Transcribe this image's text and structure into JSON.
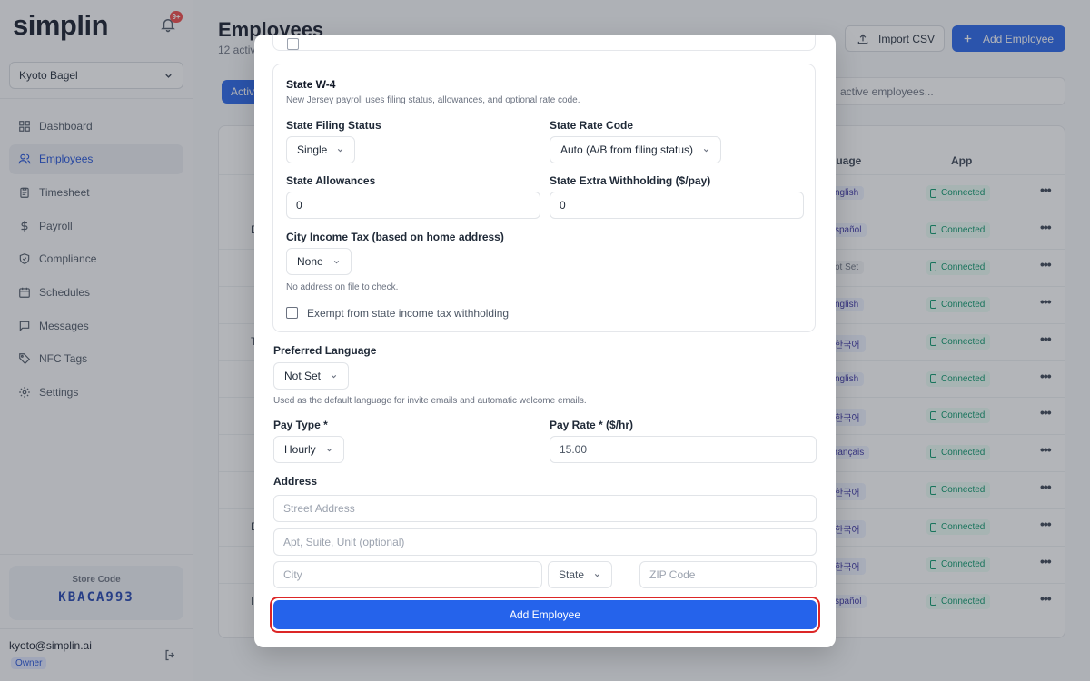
{
  "sidebar": {
    "logo": "simplin",
    "notification_count": "9+",
    "store_name": "Kyoto Bagel",
    "nav": [
      {
        "label": "Dashboard",
        "icon": "dashboard-icon"
      },
      {
        "label": "Employees",
        "icon": "users-icon",
        "active": true
      },
      {
        "label": "Timesheet",
        "icon": "clipboard-icon"
      },
      {
        "label": "Payroll",
        "icon": "dollar-icon"
      },
      {
        "label": "Compliance",
        "icon": "shield-icon"
      },
      {
        "label": "Schedules",
        "icon": "calendar-icon"
      },
      {
        "label": "Messages",
        "icon": "message-icon"
      },
      {
        "label": "NFC Tags",
        "icon": "tag-icon"
      },
      {
        "label": "Settings",
        "icon": "gear-icon"
      }
    ],
    "store_code_label": "Store Code",
    "store_code": "KBACA993",
    "user_email": "kyoto@simplin.ai",
    "user_role": "Owner"
  },
  "main": {
    "title": "Employees",
    "subtitle": "12 activ",
    "import_label": "Import CSV",
    "add_label": "Add Employee",
    "active_tab": "Activ",
    "search_placeholder": "active employees...",
    "columns": {
      "language": "guage",
      "app": "App"
    },
    "rows": [
      {
        "initial": "",
        "language": "nglish",
        "app": "Connected"
      },
      {
        "initial": "D",
        "language": "spañol",
        "app": "Connected"
      },
      {
        "initial": "",
        "language": "ot Set",
        "app": "Connected"
      },
      {
        "initial": "",
        "language": "nglish",
        "app": "Connected"
      },
      {
        "initial": "T",
        "language": "한국어",
        "app": "Connected"
      },
      {
        "initial": "",
        "language": "nglish",
        "app": "Connected"
      },
      {
        "initial": "",
        "language": "한국어",
        "app": "Connected"
      },
      {
        "initial": "",
        "language": "rançais",
        "app": "Connected"
      },
      {
        "initial": "",
        "language": "한국어",
        "app": "Connected"
      },
      {
        "initial": "D",
        "language": "한국어",
        "app": "Connected"
      },
      {
        "initial": "",
        "language": "한국어",
        "app": "Connected"
      },
      {
        "initial": "I",
        "language": "spañol",
        "app": "Connected"
      }
    ]
  },
  "modal": {
    "state_w4": {
      "title": "State W-4",
      "help": "New Jersey payroll uses filing status, allowances, and optional rate code.",
      "filing_status_label": "State Filing Status",
      "filing_status_value": "Single",
      "rate_code_label": "State Rate Code",
      "rate_code_value": "Auto (A/B from filing status)",
      "allowances_label": "State Allowances",
      "allowances_value": "0",
      "extra_withholding_label": "State Extra Withholding ($/pay)",
      "extra_withholding_value": "0",
      "city_tax_label": "City Income Tax (based on home address)",
      "city_tax_value": "None",
      "city_tax_help": "No address on file to check.",
      "exempt_label": "Exempt from state income tax withholding"
    },
    "language": {
      "label": "Preferred Language",
      "value": "Not Set",
      "help": "Used as the default language for invite emails and automatic welcome emails."
    },
    "pay": {
      "type_label": "Pay Type *",
      "type_value": "Hourly",
      "rate_label": "Pay Rate * ($/hr)",
      "rate_value": "15.00"
    },
    "address": {
      "label": "Address",
      "street_placeholder": "Street Address",
      "apt_placeholder": "Apt, Suite, Unit (optional)",
      "city_placeholder": "City",
      "state_value": "State",
      "zip_placeholder": "ZIP Code"
    },
    "submit_label": "Add Employee"
  }
}
